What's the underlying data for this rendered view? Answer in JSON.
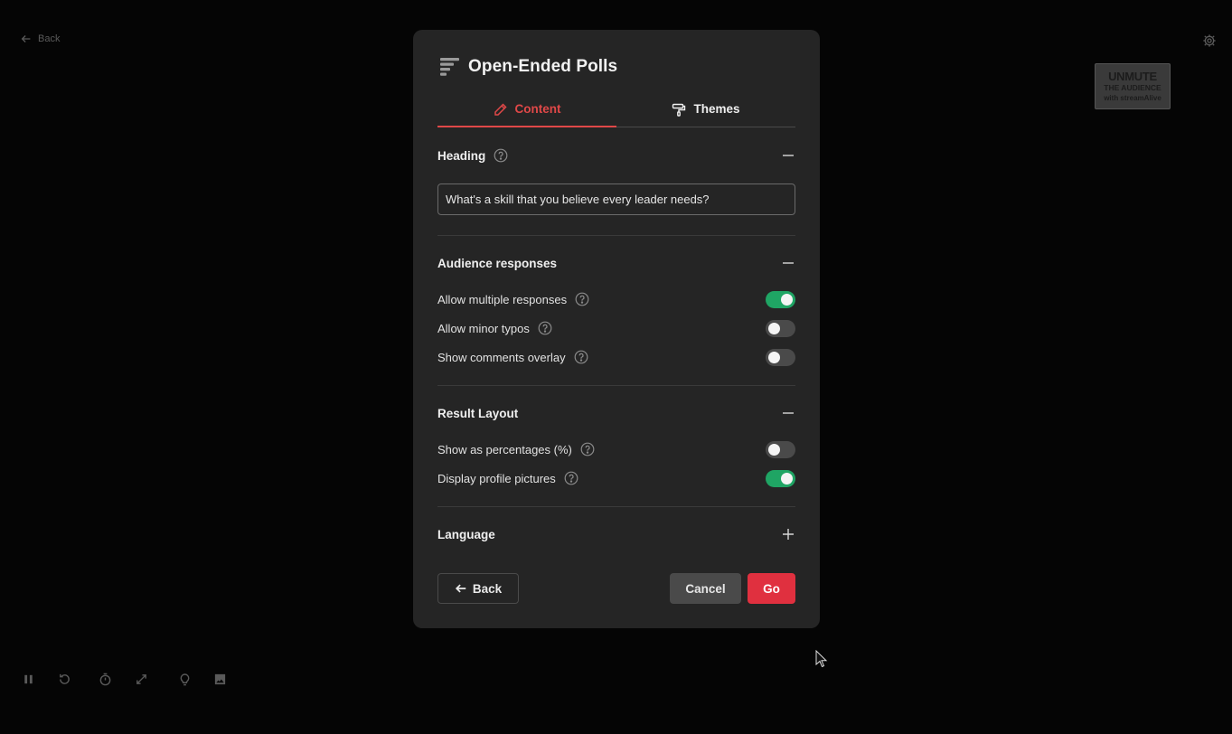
{
  "backdrop": {
    "back_label": "Back",
    "logo": {
      "line1": "UNMUTE",
      "line2": "THE AUDIENCE",
      "line3": "with streamAlive"
    },
    "bottom_toolbar": [
      "pause-icon",
      "refresh-icon",
      "timer-icon",
      "expand-icon",
      "lightbulb-icon",
      "image-icon"
    ]
  },
  "modal": {
    "title": "Open-Ended Polls",
    "tabs": [
      {
        "label": "Content",
        "icon": "pencil-icon",
        "active": true
      },
      {
        "label": "Themes",
        "icon": "paint-roller-icon",
        "active": false
      }
    ],
    "heading_section": {
      "title": "Heading",
      "value": "What's a skill that you believe every leader needs?"
    },
    "audience_section": {
      "title": "Audience responses",
      "options": [
        {
          "label": "Allow multiple responses",
          "on": true
        },
        {
          "label": "Allow minor typos",
          "on": false
        },
        {
          "label": "Show comments overlay",
          "on": false
        }
      ]
    },
    "result_section": {
      "title": "Result Layout",
      "options": [
        {
          "label": "Show as percentages (%)",
          "on": false
        },
        {
          "label": "Display profile pictures",
          "on": true
        }
      ]
    },
    "language_section": {
      "title": "Language"
    },
    "footer": {
      "back_label": "Back",
      "cancel_label": "Cancel",
      "go_label": "Go"
    }
  },
  "colors": {
    "accent_red": "#e04848",
    "go_button": "#e0303f",
    "toggle_on": "#1fa564",
    "modal_bg": "#252525",
    "page_bg": "#050505"
  }
}
